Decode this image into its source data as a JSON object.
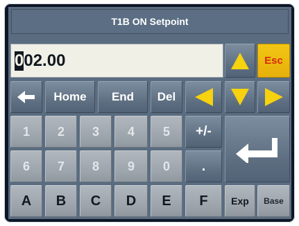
{
  "title": "T1B ON Setpoint",
  "entry": {
    "cursor_char": "0",
    "rest": "02.00"
  },
  "nav_keys": {
    "home": "Home",
    "end": "End",
    "del": "Del"
  },
  "esc_label": "Esc",
  "digits_row1": [
    "1",
    "2",
    "3",
    "4",
    "5"
  ],
  "digits_row2": [
    "6",
    "7",
    "8",
    "9",
    "0"
  ],
  "sign_label": "+/-",
  "dot_label": ".",
  "letters": [
    "A",
    "B",
    "C",
    "D",
    "E",
    "F"
  ],
  "exp_label": "Exp",
  "base_label": "Base",
  "colors": {
    "arrow_yellow": "#f6d20f",
    "esc_bg": "#e9b70c",
    "esc_text": "#d62a0b"
  },
  "icons": [
    "backspace-arrow-icon",
    "up-arrow-icon",
    "down-arrow-icon",
    "left-arrow-icon",
    "right-arrow-icon",
    "enter-icon"
  ]
}
